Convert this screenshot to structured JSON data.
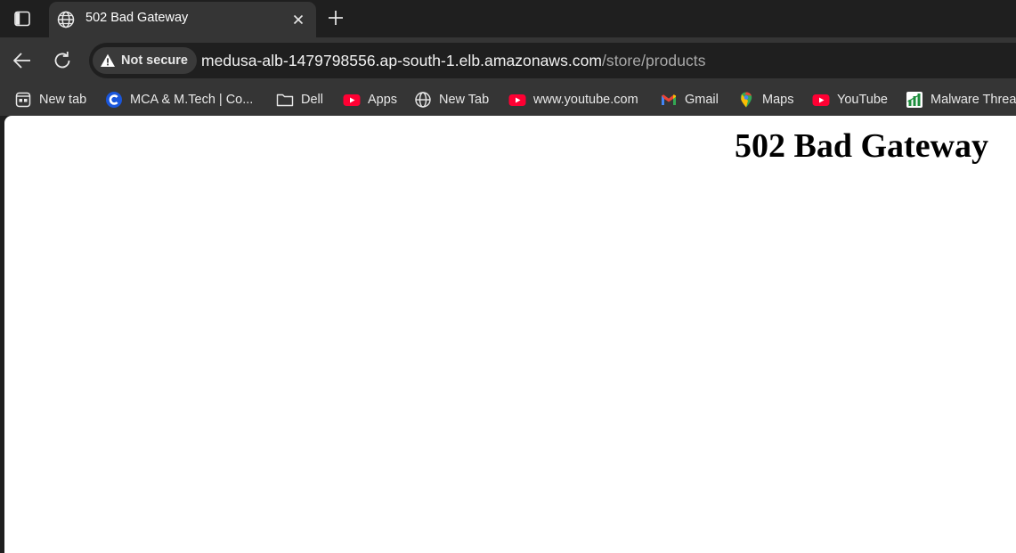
{
  "tab": {
    "title": "502 Bad Gateway",
    "favicon": "globe-icon"
  },
  "toolbar": {
    "back_icon": "arrow-left-icon",
    "reload_icon": "reload-icon",
    "security_label": "Not secure",
    "security_icon": "warning-triangle-icon",
    "url_host": "medusa-alb-1479798556.ap-south-1.elb.amazonaws.com",
    "url_path": "/store/products"
  },
  "bookmarks": [
    {
      "label": "New tab",
      "icon": "new-tab-page-icon"
    },
    {
      "label": "MCA & M.Tech | Co...",
      "icon": "c-logo-icon"
    },
    {
      "label": "Dell",
      "icon": "folder-icon"
    },
    {
      "label": "Apps",
      "icon": "youtube-icon"
    },
    {
      "label": "New Tab",
      "icon": "globe-icon"
    },
    {
      "label": "www.youtube.com",
      "icon": "youtube-icon"
    },
    {
      "label": "Gmail",
      "icon": "gmail-icon"
    },
    {
      "label": "Maps",
      "icon": "maps-pin-icon"
    },
    {
      "label": "YouTube",
      "icon": "youtube-icon"
    },
    {
      "label": "Malware Threa",
      "icon": "chart-bars-icon"
    }
  ],
  "page": {
    "heading": "502 Bad Gateway"
  },
  "colors": {
    "frame": "#1f1f1f",
    "toolbar": "#353535",
    "page_background": "#ffffff",
    "youtube_red": "#ff0033",
    "url_path": "#a8a8a8"
  }
}
